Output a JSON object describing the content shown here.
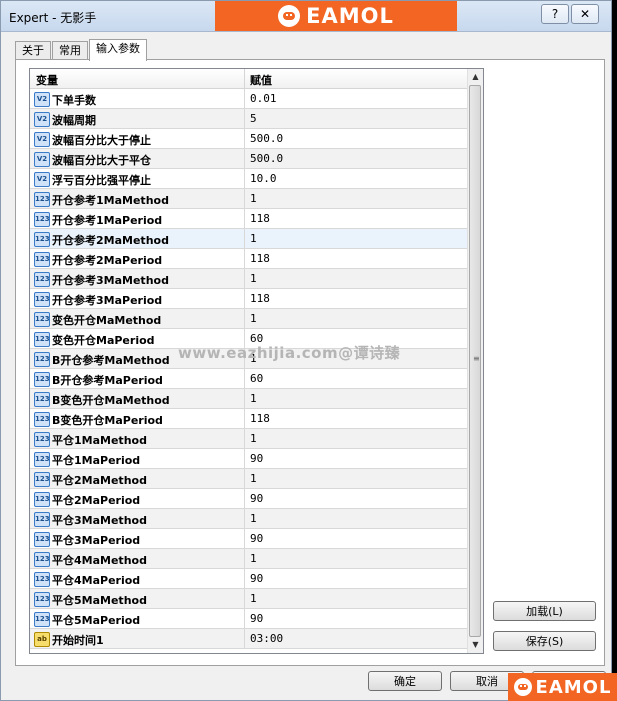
{
  "window": {
    "title": "Expert - 无影手",
    "brand_text": "EAMOL",
    "help_glyph": "?",
    "close_glyph": "✕"
  },
  "tabs": [
    {
      "label": "关于"
    },
    {
      "label": "常用"
    },
    {
      "label": "输入参数"
    }
  ],
  "grid": {
    "col_variable": "变量",
    "col_value": "赋值",
    "rows": [
      {
        "icon": "V2",
        "name": "下单手数",
        "value": "0.01"
      },
      {
        "icon": "V2",
        "name": "波幅周期",
        "value": "5"
      },
      {
        "icon": "V2",
        "name": "波幅百分比大于停止",
        "value": "500.0"
      },
      {
        "icon": "V2",
        "name": "波幅百分比大于平仓",
        "value": "500.0"
      },
      {
        "icon": "V2",
        "name": "浮亏百分比强平停止",
        "value": "10.0"
      },
      {
        "icon": "123",
        "name": "开仓参考1MaMethod",
        "value": "1"
      },
      {
        "icon": "123",
        "name": "开仓参考1MaPeriod",
        "value": "118"
      },
      {
        "icon": "123",
        "name": "开仓参考2MaMethod",
        "value": "1"
      },
      {
        "icon": "123",
        "name": "开仓参考2MaPeriod",
        "value": "118"
      },
      {
        "icon": "123",
        "name": "开仓参考3MaMethod",
        "value": "1"
      },
      {
        "icon": "123",
        "name": "开仓参考3MaPeriod",
        "value": "118"
      },
      {
        "icon": "123",
        "name": "变色开仓MaMethod",
        "value": "1"
      },
      {
        "icon": "123",
        "name": "变色开仓MaPeriod",
        "value": "60"
      },
      {
        "icon": "123",
        "name": "B开仓参考MaMethod",
        "value": "1"
      },
      {
        "icon": "123",
        "name": "B开仓参考MaPeriod",
        "value": "60"
      },
      {
        "icon": "123",
        "name": "B变色开仓MaMethod",
        "value": "1"
      },
      {
        "icon": "123",
        "name": "B变色开仓MaPeriod",
        "value": "118"
      },
      {
        "icon": "123",
        "name": "平仓1MaMethod",
        "value": "1"
      },
      {
        "icon": "123",
        "name": "平仓1MaPeriod",
        "value": "90"
      },
      {
        "icon": "123",
        "name": "平仓2MaMethod",
        "value": "1"
      },
      {
        "icon": "123",
        "name": "平仓2MaPeriod",
        "value": "90"
      },
      {
        "icon": "123",
        "name": "平仓3MaMethod",
        "value": "1"
      },
      {
        "icon": "123",
        "name": "平仓3MaPeriod",
        "value": "90"
      },
      {
        "icon": "123",
        "name": "平仓4MaMethod",
        "value": "1"
      },
      {
        "icon": "123",
        "name": "平仓4MaPeriod",
        "value": "90"
      },
      {
        "icon": "123",
        "name": "平仓5MaMethod",
        "value": "1"
      },
      {
        "icon": "123",
        "name": "平仓5MaPeriod",
        "value": "90"
      },
      {
        "icon": "ab",
        "name": "开始时间1",
        "value": "03:00"
      }
    ]
  },
  "buttons": {
    "load": "加载(L)",
    "save": "保存(S)",
    "ok": "确定",
    "cancel": "取消"
  },
  "watermark": "www.eazhijia.com@谭诗臻"
}
